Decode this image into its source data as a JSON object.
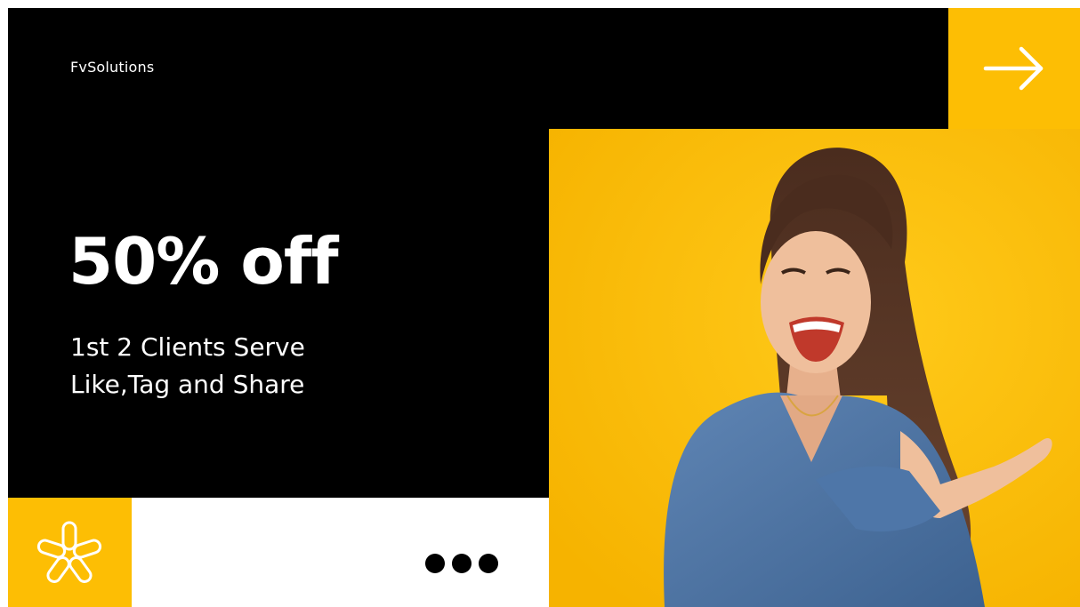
{
  "brand": {
    "name": "FvSolutions"
  },
  "promo": {
    "headline": "50% off",
    "lines": [
      "1st 2 Clients Serve",
      "Like,Tag and Share"
    ]
  },
  "colors": {
    "background": "#000000",
    "accent": "#FDBE04",
    "text": "#FFFFFF"
  },
  "icons": {
    "arrow": "arrow-right-icon",
    "asterisk": "asterisk-icon",
    "more": "more-dots-icon"
  }
}
